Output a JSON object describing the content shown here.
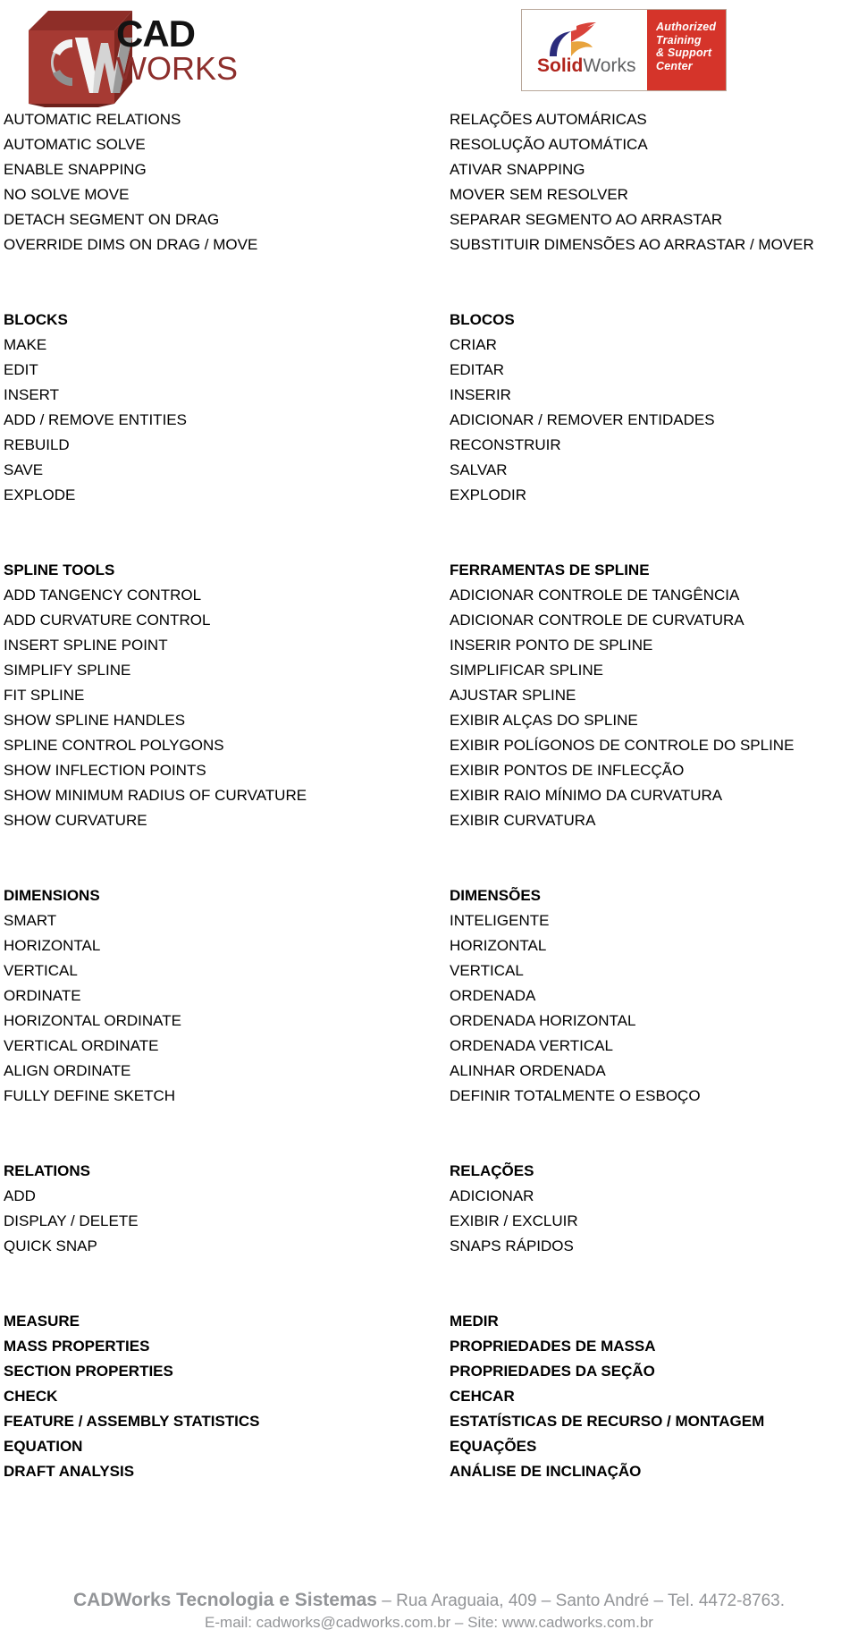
{
  "header": {
    "cadworks_logo": {
      "icon": "cadworks-cube-logo",
      "cube_letters": "CW",
      "line1": "CAD",
      "line2": "WORKS",
      "cube_color": "#a63a33",
      "word_color_line1": "#131313",
      "word_color_line2": "#8d2f2c"
    },
    "solidworks_badge": {
      "icon": "dassault-systemes-3ds-icon",
      "brand_bold": "Solid",
      "brand_regular": "Works",
      "panel_line1": "Authorized",
      "panel_line2": "Training",
      "panel_line3": "& Support",
      "panel_line4": "Center",
      "panel_color": "#d5342a",
      "brand_bold_color": "#b0241c",
      "brand_regular_color": "#5f6062"
    }
  },
  "sections": [
    {
      "id": "automatic",
      "heading": null,
      "rows": [
        {
          "en": "AUTOMATIC RELATIONS",
          "pt": "RELAÇÕES AUTOMÁRICAS"
        },
        {
          "en": "AUTOMATIC SOLVE",
          "pt": "RESOLUÇÃO AUTOMÁTICA"
        },
        {
          "en": "ENABLE SNAPPING",
          "pt": "ATIVAR SNAPPING"
        },
        {
          "en": "NO SOLVE MOVE",
          "pt": "MOVER SEM RESOLVER"
        },
        {
          "en": "DETACH SEGMENT ON DRAG",
          "pt": "SEPARAR SEGMENTO AO ARRASTAR"
        },
        {
          "en": "OVERRIDE DIMS ON DRAG / MOVE",
          "pt": "SUBSTITUIR DIMENSÕES AO ARRASTAR / MOVER"
        }
      ]
    },
    {
      "id": "blocks",
      "heading": {
        "en": "BLOCKS",
        "pt": "BLOCOS"
      },
      "rows": [
        {
          "en": "MAKE",
          "pt": "CRIAR"
        },
        {
          "en": "EDIT",
          "pt": "EDITAR"
        },
        {
          "en": "INSERT",
          "pt": "INSERIR"
        },
        {
          "en": "ADD / REMOVE ENTITIES",
          "pt": "ADICIONAR / REMOVER ENTIDADES"
        },
        {
          "en": "REBUILD",
          "pt": "RECONSTRUIR"
        },
        {
          "en": "SAVE",
          "pt": "SALVAR"
        },
        {
          "en": "EXPLODE",
          "pt": "EXPLODIR"
        }
      ]
    },
    {
      "id": "spline-tools",
      "heading": {
        "en": "SPLINE TOOLS",
        "pt": "FERRAMENTAS DE SPLINE"
      },
      "rows": [
        {
          "en": "ADD TANGENCY CONTROL",
          "pt": "ADICIONAR CONTROLE DE TANGÊNCIA"
        },
        {
          "en": "ADD CURVATURE CONTROL",
          "pt": "ADICIONAR CONTROLE DE CURVATURA"
        },
        {
          "en": "INSERT SPLINE POINT",
          "pt": "INSERIR PONTO DE SPLINE"
        },
        {
          "en": "SIMPLIFY SPLINE",
          "pt": "SIMPLIFICAR SPLINE"
        },
        {
          "en": "FIT SPLINE",
          "pt": "AJUSTAR SPLINE"
        },
        {
          "en": "SHOW SPLINE HANDLES",
          "pt": "EXIBIR ALÇAS DO SPLINE"
        },
        {
          "en": "SPLINE CONTROL POLYGONS",
          "pt": "EXIBIR POLÍGONOS DE CONTROLE DO SPLINE"
        },
        {
          "en": "SHOW INFLECTION POINTS",
          "pt": "EXIBIR PONTOS DE INFLECÇÃO"
        },
        {
          "en": "SHOW MINIMUM RADIUS OF CURVATURE",
          "pt": "EXIBIR RAIO MÍNIMO DA CURVATURA"
        },
        {
          "en": "SHOW CURVATURE",
          "pt": "EXIBIR CURVATURA"
        }
      ]
    },
    {
      "id": "dimensions",
      "heading": {
        "en": "DIMENSIONS",
        "pt": "DIMENSÕES"
      },
      "rows": [
        {
          "en": "SMART",
          "pt": "INTELIGENTE"
        },
        {
          "en": "HORIZONTAL",
          "pt": "HORIZONTAL"
        },
        {
          "en": "VERTICAL",
          "pt": "VERTICAL"
        },
        {
          "en": "ORDINATE",
          "pt": "ORDENADA"
        },
        {
          "en": "HORIZONTAL ORDINATE",
          "pt": "ORDENADA HORIZONTAL"
        },
        {
          "en": "VERTICAL ORDINATE",
          "pt": "ORDENADA VERTICAL"
        },
        {
          "en": "ALIGN ORDINATE",
          "pt": "ALINHAR ORDENADA"
        },
        {
          "en": "FULLY DEFINE SKETCH",
          "pt": "DEFINIR TOTALMENTE O ESBOÇO"
        }
      ]
    },
    {
      "id": "relations",
      "heading": {
        "en": "RELATIONS",
        "pt": "RELAÇÕES"
      },
      "rows": [
        {
          "en": "ADD",
          "pt": "ADICIONAR"
        },
        {
          "en": "DISPLAY / DELETE",
          "pt": "EXIBIR / EXCLUIR"
        },
        {
          "en": "QUICK SNAP",
          "pt": "SNAPS RÁPIDOS"
        }
      ]
    },
    {
      "id": "tools",
      "heading": null,
      "bold": true,
      "rows": [
        {
          "en": "MEASURE",
          "pt": "MEDIR"
        },
        {
          "en": "MASS PROPERTIES",
          "pt": "PROPRIEDADES DE MASSA"
        },
        {
          "en": "SECTION PROPERTIES",
          "pt": "PROPRIEDADES DA SEÇÃO"
        },
        {
          "en": "CHECK",
          "pt": "CEHCAR"
        },
        {
          "en": "FEATURE / ASSEMBLY STATISTICS",
          "pt": "ESTATÍSTICAS DE RECURSO / MONTAGEM"
        },
        {
          "en": "EQUATION",
          "pt": "EQUAÇÕES"
        },
        {
          "en": "DRAFT ANALYSIS",
          "pt": "ANÁLISE DE INCLINAÇÃO"
        }
      ]
    }
  ],
  "footer": {
    "company": "CADWorks Tecnologia e Sistemas",
    "address": " – Rua Araguaia, 409 – Santo André – Tel. 4472-8763.",
    "contact": "E-mail: cadworks@cadworks.com.br – Site: www.cadworks.com.br",
    "color": "#939598"
  }
}
